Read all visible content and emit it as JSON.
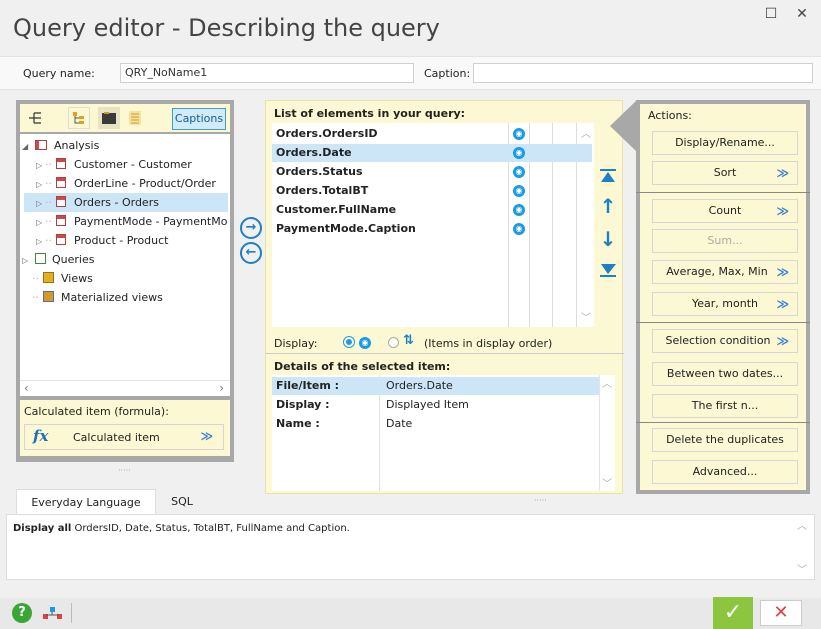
{
  "window": {
    "title": "Query editor - Describing the query",
    "maximize_glyph": "☐",
    "close_glyph": "✕"
  },
  "query": {
    "name_label": "Query name:",
    "name_value": "QRY_NoName1",
    "caption_label": "Caption:",
    "caption_value": ""
  },
  "tree": {
    "captions_button": "Captions",
    "items": [
      {
        "label": "Analysis",
        "icon": "analysis-icon"
      },
      {
        "label": "Customer - Customer",
        "icon": "table-icon"
      },
      {
        "label": "OrderLine - Product/Order",
        "icon": "table-icon"
      },
      {
        "label": "Orders - Orders",
        "icon": "table-icon",
        "selected": true
      },
      {
        "label": "PaymentMode - PaymentMod",
        "icon": "table-icon"
      },
      {
        "label": "Product - Product",
        "icon": "table-icon"
      },
      {
        "label": "Queries",
        "icon": "queries-icon"
      },
      {
        "label": "Views",
        "icon": "views-icon"
      },
      {
        "label": "Materialized views",
        "icon": "materialized-views-icon"
      }
    ]
  },
  "calculated": {
    "header": "Calculated item (formula):",
    "button": "Calculated item",
    "fx": "fx"
  },
  "elements": {
    "header": "List of elements in your query:",
    "items": [
      {
        "label": "Orders.OrdersID"
      },
      {
        "label": "Orders.Date",
        "selected": true
      },
      {
        "label": "Orders.Status"
      },
      {
        "label": "Orders.TotalBT"
      },
      {
        "label": "Customer.FullName"
      },
      {
        "label": "PaymentMode.Caption"
      }
    ],
    "display_label": "Display:",
    "display_order_text": "(Items in display order)"
  },
  "details": {
    "header": "Details of the selected item:",
    "rows": [
      {
        "key": "File/Item :",
        "value": "Orders.Date",
        "selected": true
      },
      {
        "key": "Display :",
        "value": "Displayed Item"
      },
      {
        "key": "Name :",
        "value": "Date"
      }
    ]
  },
  "actions": {
    "header": "Actions:",
    "buttons": {
      "display_rename": "Display/Rename...",
      "sort": "Sort",
      "count": "Count",
      "sum": "Sum...",
      "average": "Average, Max, Min",
      "year_month": "Year, month",
      "selection": "Selection condition",
      "between": "Between two dates...",
      "first_n": "The first n...",
      "duplicates": "Delete the duplicates",
      "advanced": "Advanced..."
    }
  },
  "tabs": {
    "everyday": "Everyday Language",
    "sql": "SQL"
  },
  "description": {
    "prefix": "Display all",
    "rest": " OrdersID, Date, Status, TotalBT, FullName and Caption."
  },
  "footer": {
    "ok_glyph": "✓",
    "cancel_glyph": "✕",
    "help_glyph": "?"
  },
  "colors": {
    "accent": "#1b9be0",
    "panel_yellow": "#fbf8d3",
    "panel_gray": "#a8a8a8",
    "selection": "#cde6f7",
    "ok_green": "#8cc63f",
    "cancel_red": "#e04040"
  }
}
